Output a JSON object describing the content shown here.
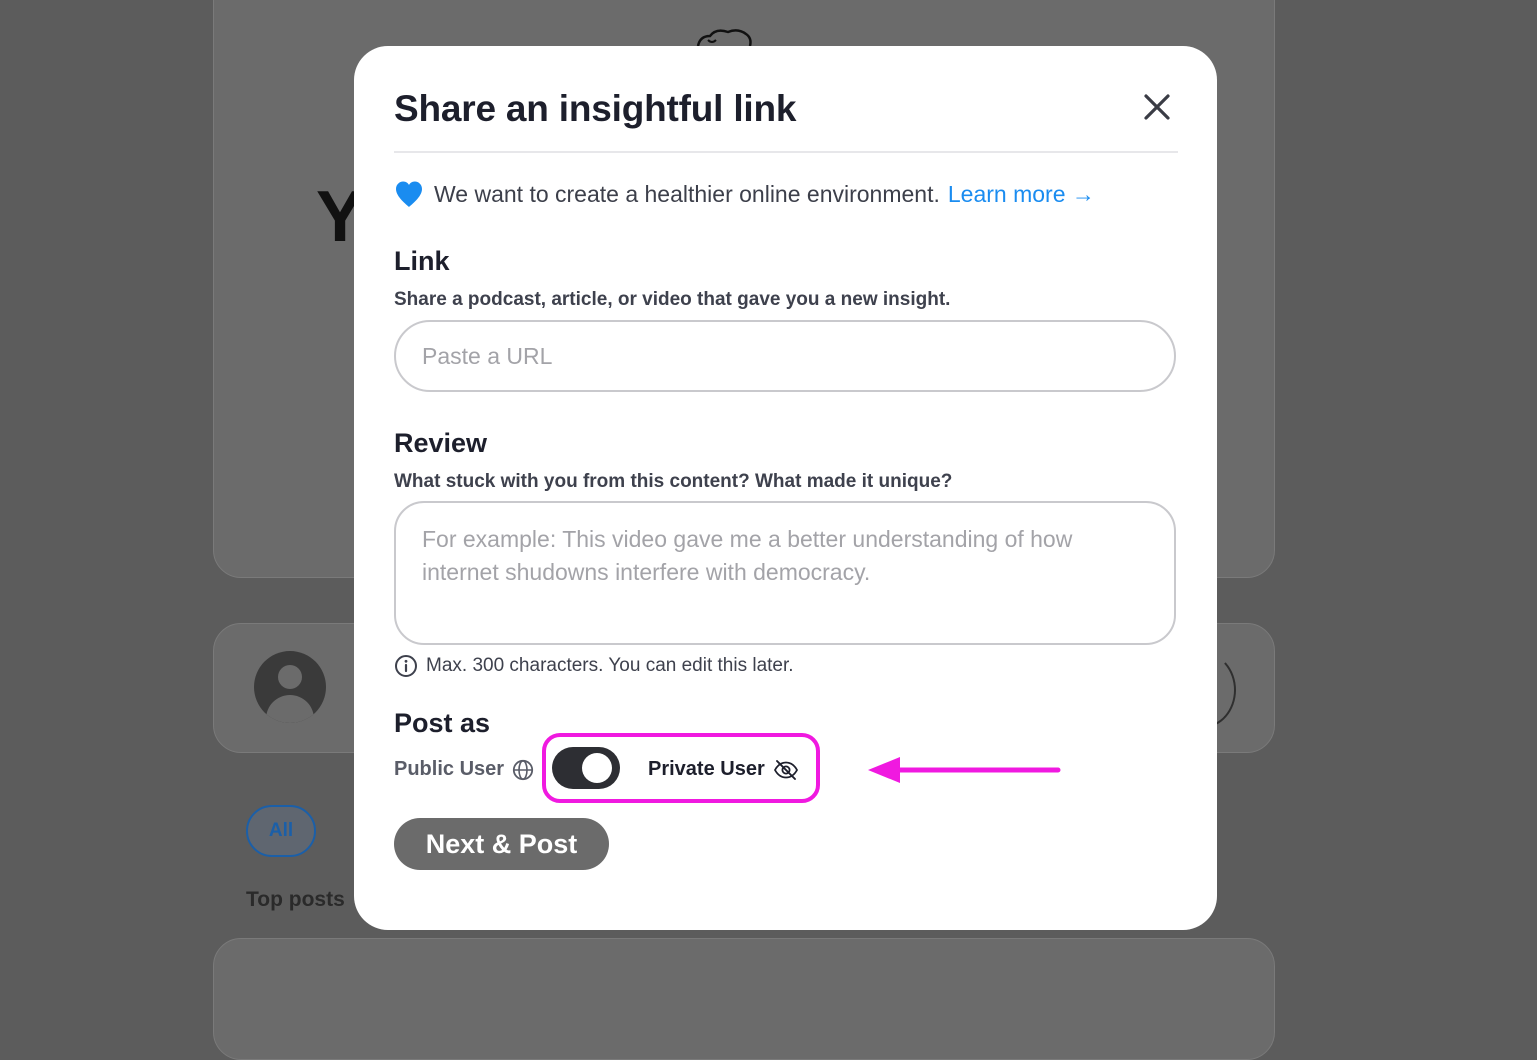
{
  "background": {
    "heading_letter": "Y",
    "filter_all_label": "All",
    "top_posts_label": "Top posts"
  },
  "modal": {
    "title": "Share an insightful link",
    "notice": {
      "text": "We want to create a healthier online environment.",
      "link_label": "Learn more →"
    },
    "link_section": {
      "label": "Link",
      "help": "Share a podcast, article, or video that gave you a new insight.",
      "input_value": "",
      "input_placeholder": "Paste a URL"
    },
    "review_section": {
      "label": "Review",
      "help": "What stuck with you from this content? What made it unique?",
      "input_value": "",
      "input_placeholder": "For example: This video gave me a better understanding of how internet shudowns interfere with democracy.",
      "hint": "Max. 300 characters. You can edit this later."
    },
    "post_as": {
      "label": "Post as",
      "public_label": "Public User",
      "private_label": "Private User",
      "toggle_state": "private"
    },
    "submit_label": "Next & Post"
  },
  "colors": {
    "accent_link": "#1a8cf0",
    "heart": "#1a8cf0",
    "annotation": "#f019e0",
    "toggle_on": "#2d2e33",
    "submit_button": "#6b6b6b"
  },
  "icons": {
    "close": "close-icon",
    "heart": "heart-icon",
    "info": "info-icon",
    "globe": "globe-icon",
    "eye_off": "eye-off-icon"
  }
}
